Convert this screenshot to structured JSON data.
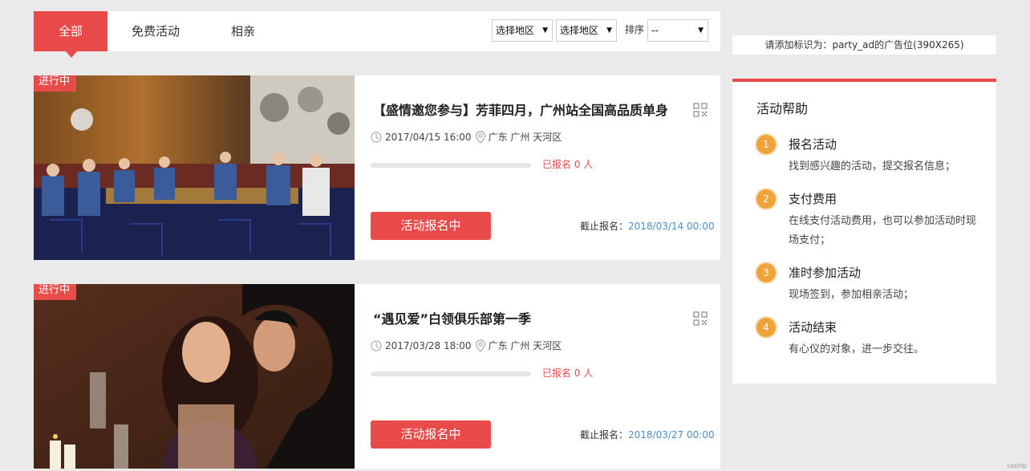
{
  "tabs": [
    {
      "label": "全部",
      "active": true
    },
    {
      "label": "免费活动",
      "active": false
    },
    {
      "label": "相亲",
      "active": false
    }
  ],
  "filters": {
    "region1": "选择地区",
    "region2": "选择地区",
    "sort_label": "排序",
    "sort_value": "--"
  },
  "events": [
    {
      "status": "进行中",
      "title": "【盛情邀您参与】芳菲四月，广州站全国高品质单身",
      "datetime": "2017/04/15 16:00",
      "location": "广东 广州 天河区",
      "enrolled": "已报名 0 人",
      "enrolled_fraction": 0,
      "button": "活动报名中",
      "deadline_label": "截止报名：",
      "deadline": "2018/03/14 00:00"
    },
    {
      "status": "进行中",
      "title": "“遇见爱”白领俱乐部第一季",
      "datetime": "2017/03/28 18:00",
      "location": "广东 广州 天河区",
      "enrolled": "已报名 0 人",
      "enrolled_fraction": 0,
      "button": "活动报名中",
      "deadline_label": "截止报名：",
      "deadline": "2018/03/27 00:00"
    }
  ],
  "ad_text": "请添加标识为：party_ad的广告位(390X265)",
  "help": {
    "title": "活动帮助",
    "steps": [
      {
        "num": "1",
        "title": "报名活动",
        "desc": "找到感兴趣的活动，提交报名信息；"
      },
      {
        "num": "2",
        "title": "支付费用",
        "desc": "在线支付活动费用，也可以参加活动时现场支付；"
      },
      {
        "num": "3",
        "title": "准时参加活动",
        "desc": "现场签到，参加相亲活动；"
      },
      {
        "num": "4",
        "title": "活动结束",
        "desc": "有心仪的对象，进一步交往。"
      }
    ]
  },
  "corner_logo": "cephp",
  "colors": {
    "accent": "#e94b4b",
    "step": "#f0a33a",
    "deadline": "#4a90c8"
  }
}
